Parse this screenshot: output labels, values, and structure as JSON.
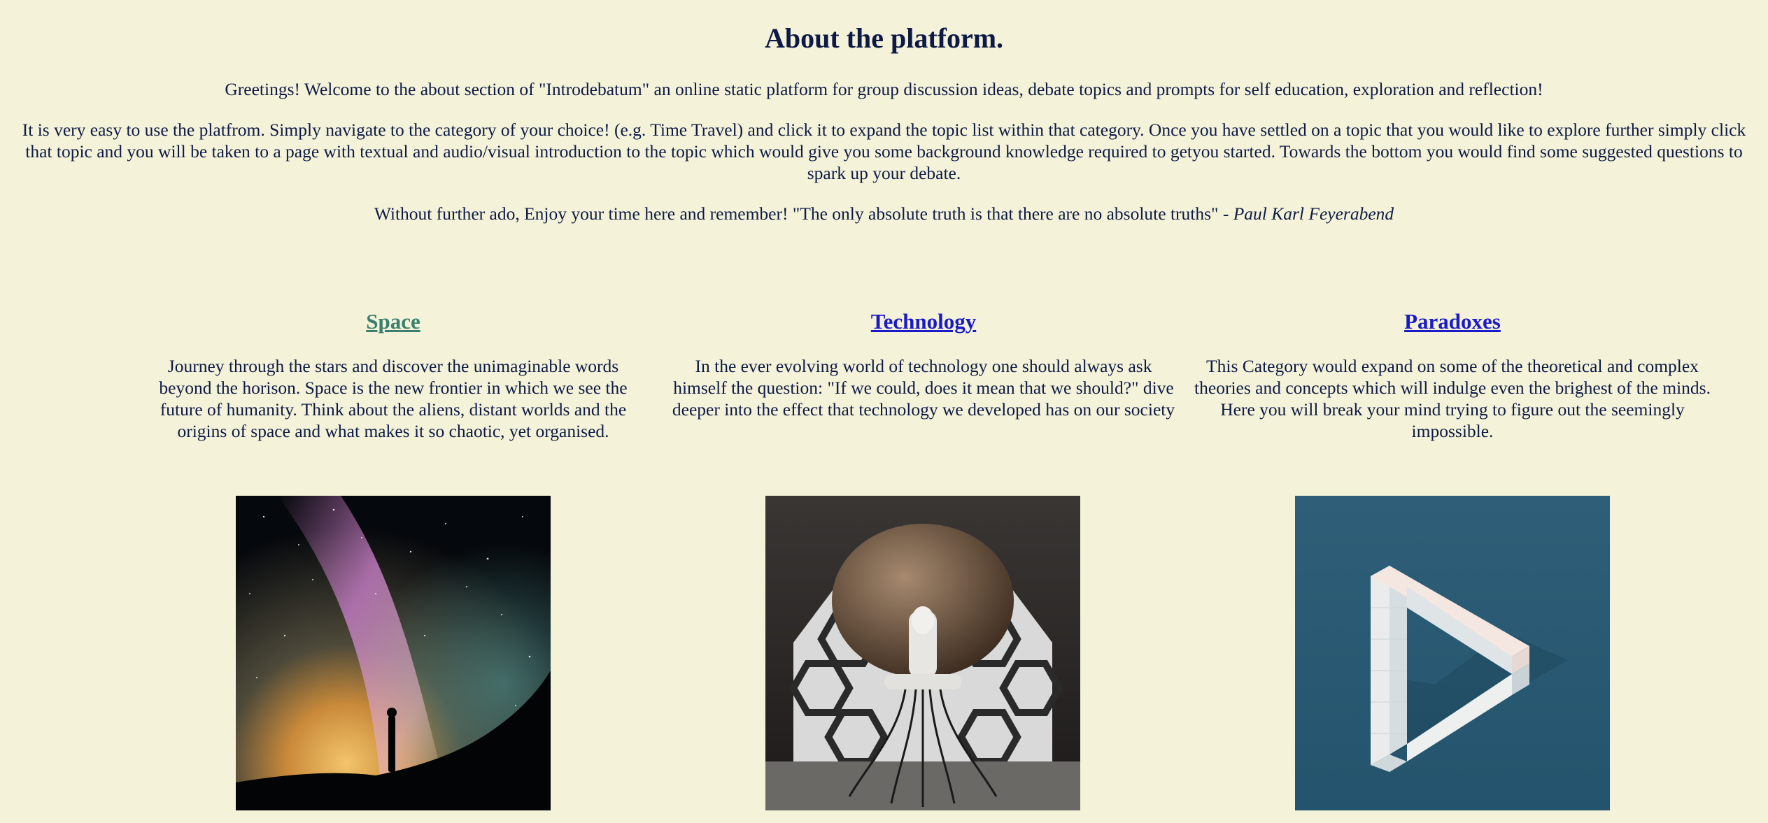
{
  "about": {
    "title": "About the platform.",
    "greeting": "Greetings! Welcome to the about section of \"Introdebatum\" an online static platform for group discussion ideas, debate topics and prompts for self education, exploration and reflection!",
    "instructions": "It is very easy to use the platfrom. Simply navigate to the category of your choice! (e.g. Time Travel) and click it to expand the topic list within that category. Once you have settled on a topic that you would like to explore further simply click that topic and you will be taken to a page with textual and audio/visual introduction to the topic which would give you some background knowledge required to getyou started. Towards the bottom you would find some suggested questions to spark up your debate.",
    "closing": "Without further ado, Enjoy your time here and remember! \"The only absolute truth is that there are no absolute truths\" - ",
    "quote_author": "Paul Karl Feyerabend"
  },
  "categories": [
    {
      "title": "Space",
      "description": "Journey through the stars and discover the unimaginable words beyond the horison. Space is the new frontier in which we see the future of humanity. Think about the aliens, distant worlds and the origins of space and what makes it so chaotic, yet organised.",
      "link_color": "#3b7f6e",
      "image": "milky-way-night-sky-silhouette"
    },
    {
      "title": "Technology",
      "description": "In the ever evolving world of technology one should always ask himself the question: \"If we could, does it mean that we should?\" dive deeper into the effect that technology we developed has on our society",
      "link_color": "#1a1ac8",
      "image": "robot-seated-in-hexagonal-room"
    },
    {
      "title": "Paradoxes",
      "description": "This Category would expand on some of the theoretical and complex theories and concepts which will indulge even the brighest of the minds. Here you will break your mind trying to figure out the seemingly impossible.",
      "link_color": "#1a1ac8",
      "image": "impossible-triangle-cubes"
    }
  ],
  "colors": {
    "background": "#f4f3d9",
    "text": "#0e1a45"
  }
}
